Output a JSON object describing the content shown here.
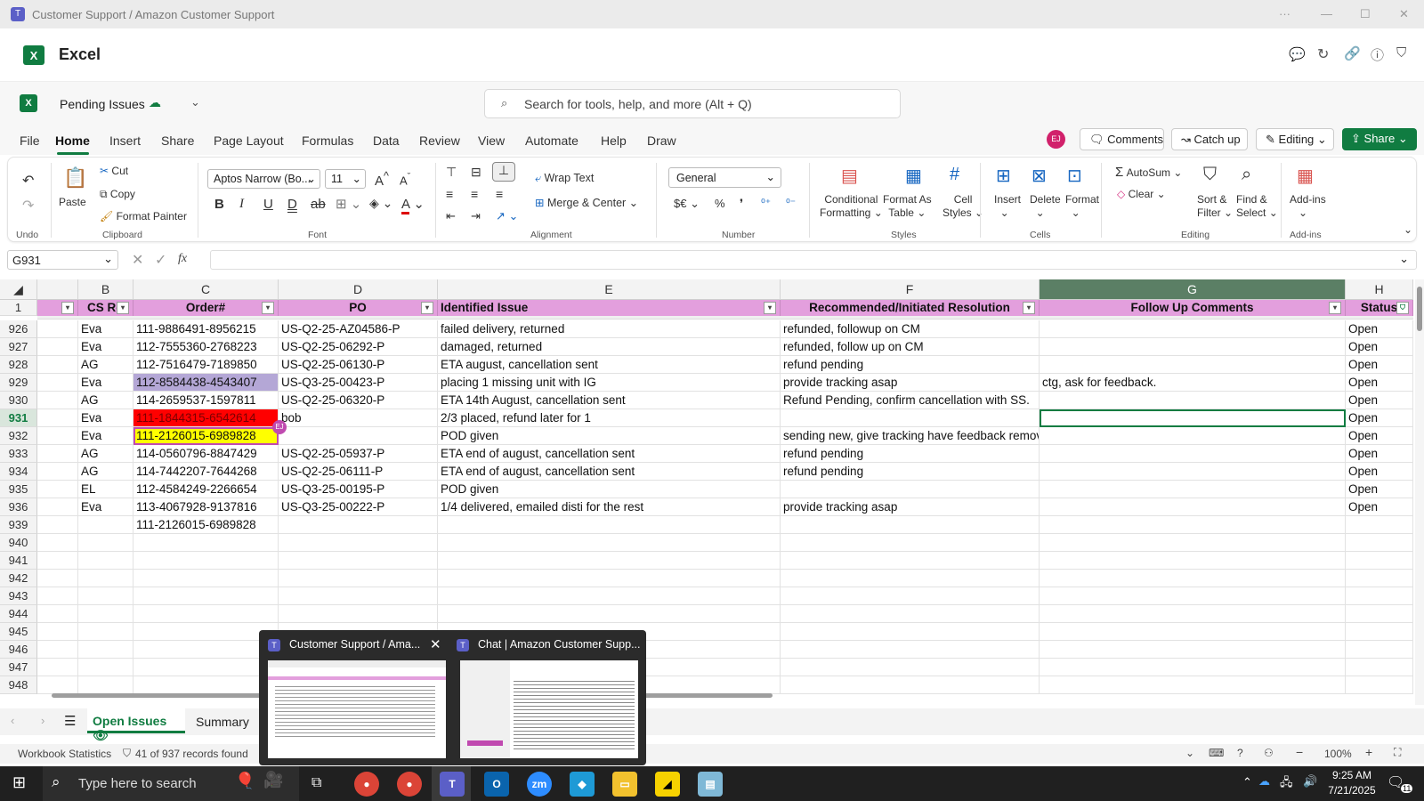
{
  "window": {
    "title": "Customer Support / Amazon Customer Support",
    "more": "···"
  },
  "app": {
    "name": "Excel"
  },
  "doc": {
    "title": "Pending Issues",
    "search_placeholder": "Search for tools, help, and more (Alt + Q)",
    "user_initials": "EJ",
    "comments": "Comments",
    "catchup": "Catch up",
    "editing": "Editing",
    "share": "Share"
  },
  "menu": [
    "File",
    "Home",
    "Insert",
    "Share",
    "Page Layout",
    "Formulas",
    "Data",
    "Review",
    "View",
    "Automate",
    "Help",
    "Draw"
  ],
  "ribbon": {
    "undo_label": "Undo",
    "paste": "Paste",
    "cut": "Cut",
    "copy": "Copy",
    "format_painter": "Format Painter",
    "clipboard_label": "Clipboard",
    "font_name": "Aptos Narrow (Bo...",
    "font_size": "11",
    "font_label": "Font",
    "wrap_text": "Wrap Text",
    "merge_center": "Merge & Center",
    "alignment_label": "Alignment",
    "number_format": "General",
    "number_label": "Number",
    "conditional": "Conditional",
    "formatting": "Formatting",
    "format_as": "Format As",
    "table": "Table",
    "cell": "Cell",
    "styles": "Styles",
    "styles_label": "Styles",
    "insert": "Insert",
    "delete": "Delete",
    "format": "Format",
    "cells_label": "Cells",
    "autosum": "AutoSum",
    "clear": "Clear",
    "sort": "Sort &",
    "filter": "Filter",
    "find": "Find &",
    "select": "Select",
    "editing_label": "Editing",
    "addins": "Add-ins",
    "addins_label": "Add-ins"
  },
  "formula_bar": {
    "name_box": "G931",
    "fx": "fx",
    "value": ""
  },
  "columns": [
    {
      "letter": "B",
      "header": "CS Re"
    },
    {
      "letter": "C",
      "header": "Order#"
    },
    {
      "letter": "D",
      "header": "PO"
    },
    {
      "letter": "E",
      "header": "Identified Issue"
    },
    {
      "letter": "F",
      "header": "Recommended/Initiated Resolution"
    },
    {
      "letter": "G",
      "header": "Follow Up Comments"
    },
    {
      "letter": "H",
      "header": "Status"
    }
  ],
  "header_row_num": "1",
  "rows": [
    {
      "n": "926",
      "b": "Eva",
      "c": "111-9886491-8956215",
      "d": "US-Q2-25-AZ04586-P",
      "e": "failed delivery, returned",
      "f": "refunded, followup on CM",
      "g": "",
      "h": "Open"
    },
    {
      "n": "927",
      "b": "Eva",
      "c": "112-7555360-2768223",
      "d": "US-Q2-25-06292-P",
      "e": "damaged, returned",
      "f": "refunded, follow up on CM",
      "g": "",
      "h": "Open"
    },
    {
      "n": "928",
      "b": "AG",
      "c": "112-7516479-7189850",
      "d": "US-Q2-25-06130-P",
      "e": "ETA august, cancellation sent",
      "f": "refund pending",
      "g": "",
      "h": "Open"
    },
    {
      "n": "929",
      "b": "Eva",
      "c": "112-8584438-4543407",
      "d": "US-Q3-25-00423-P",
      "e": "placing 1 missing unit with IG",
      "f": "provide tracking asap",
      "g": "ctg, ask for feedback.",
      "h": "Open"
    },
    {
      "n": "930",
      "b": "AG",
      "c": "114-2659537-1597811",
      "d": "US-Q2-25-06320-P",
      "e": "ETA 14th August, cancellation sent",
      "f": "Refund Pending, confirm cancellation with SS.",
      "g": "",
      "h": "Open"
    },
    {
      "n": "931",
      "b": "Eva",
      "c": "111-1844315-6542614",
      "d": "bob",
      "e": "2/3 placed, refund later for 1",
      "f": "",
      "g": "",
      "h": "Open"
    },
    {
      "n": "932",
      "b": "Eva",
      "c": "111-2126015-6989828",
      "d": "",
      "e": "POD given",
      "f": "sending new, give tracking have feedback removed",
      "g": "",
      "h": "Open"
    },
    {
      "n": "933",
      "b": "AG",
      "c": "114-0560796-8847429",
      "d": "US-Q2-25-05937-P",
      "e": "ETA end of august, cancellation sent",
      "f": "refund pending",
      "g": "",
      "h": "Open"
    },
    {
      "n": "934",
      "b": "AG",
      "c": "114-7442207-7644268",
      "d": "US-Q2-25-06111-P",
      "e": "ETA end of august, cancellation sent",
      "f": "refund pending",
      "g": "",
      "h": "Open"
    },
    {
      "n": "935",
      "b": "EL",
      "c": "112-4584249-2266654",
      "d": "US-Q3-25-00195-P",
      "e": "POD given",
      "f": "",
      "g": "",
      "h": "Open"
    },
    {
      "n": "936",
      "b": "Eva",
      "c": "113-4067928-9137816",
      "d": "US-Q3-25-00222-P",
      "e": "1/4 delivered, emailed disti for the rest",
      "f": "provide tracking asap",
      "g": "",
      "h": "Open"
    },
    {
      "n": "939",
      "b": "",
      "c": "111-2126015-6989828",
      "d": "",
      "e": "",
      "f": "",
      "g": "",
      "h": ""
    },
    {
      "n": "940",
      "b": "",
      "c": "",
      "d": "",
      "e": "",
      "f": "",
      "g": "",
      "h": ""
    },
    {
      "n": "941",
      "b": "",
      "c": "",
      "d": "",
      "e": "",
      "f": "",
      "g": "",
      "h": ""
    },
    {
      "n": "942",
      "b": "",
      "c": "",
      "d": "",
      "e": "",
      "f": "",
      "g": "",
      "h": ""
    },
    {
      "n": "943",
      "b": "",
      "c": "",
      "d": "",
      "e": "",
      "f": "",
      "g": "",
      "h": ""
    },
    {
      "n": "944",
      "b": "",
      "c": "",
      "d": "",
      "e": "",
      "f": "",
      "g": "",
      "h": ""
    },
    {
      "n": "945",
      "b": "",
      "c": "",
      "d": "",
      "e": "",
      "f": "",
      "g": "",
      "h": ""
    },
    {
      "n": "946",
      "b": "",
      "c": "",
      "d": "",
      "e": "",
      "f": "",
      "g": "",
      "h": ""
    },
    {
      "n": "947",
      "b": "",
      "c": "",
      "d": "",
      "e": "",
      "f": "",
      "g": "",
      "h": ""
    },
    {
      "n": "948",
      "b": "",
      "c": "",
      "d": "",
      "e": "",
      "f": "",
      "g": "",
      "h": ""
    }
  ],
  "collaborator_badge": "EJ",
  "sheets": {
    "active": "Open Issues",
    "other": "Summary"
  },
  "status": {
    "stats": "Workbook Statistics",
    "records": "41 of 937 records found",
    "zoom": "100%"
  },
  "taskbar": {
    "search": "Type here to search",
    "time": "9:25 AM",
    "date": "7/21/2025",
    "notif": "11"
  },
  "previews": [
    {
      "title": "Customer Support / Ama..."
    },
    {
      "title": "Chat | Amazon Customer Supp..."
    }
  ],
  "colors": {
    "header_fill": "#e39fdd",
    "red_fill": "#ff0000",
    "yellow_fill": "#ffff00",
    "purple_sel": "#b4a7d6",
    "accent": "#107c41"
  }
}
